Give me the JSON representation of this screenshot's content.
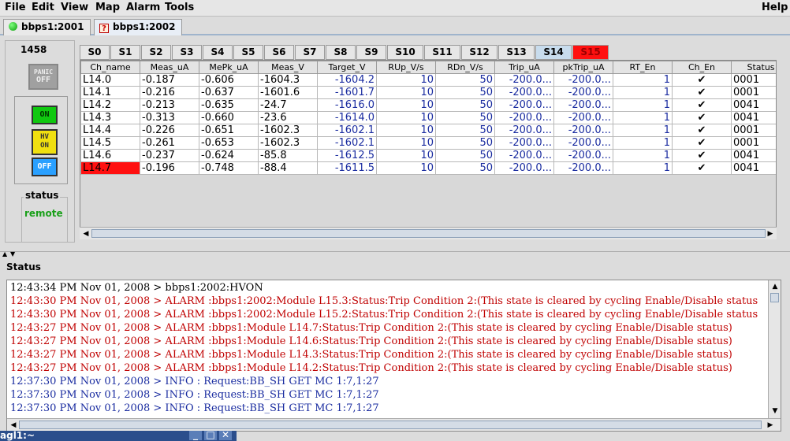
{
  "menu": [
    "File",
    "Edit",
    "View",
    "Map",
    "Alarm",
    "Tools"
  ],
  "help": "Help",
  "window_tabs": [
    {
      "label": "bbps1:2001"
    },
    {
      "label": "bbps1:2002"
    }
  ],
  "crate": "1458",
  "controls": {
    "panic_top": "PANIC",
    "panic_bottom": "OFF",
    "on": "ON",
    "hv_top": "HV",
    "hv_bottom": "ON",
    "off": "OFF"
  },
  "status": {
    "title": "status",
    "value": "remote"
  },
  "slot_tabs": [
    "S0",
    "S1",
    "S2",
    "S3",
    "S4",
    "S5",
    "S6",
    "S7",
    "S8",
    "S9",
    "S10",
    "S11",
    "S12",
    "S13",
    "S14",
    "S15"
  ],
  "columns": [
    "Ch_name",
    "Meas_uA",
    "MePk_uA",
    "Meas_V",
    "Target_V",
    "RUp_V/s",
    "RDn_V/s",
    "Trip_uA",
    "pkTrip_uA",
    "RT_En",
    "Ch_En",
    "Status"
  ],
  "rows": [
    [
      "L14.0",
      "-0.187",
      "-0.606",
      "-1604.3",
      "-1604.2",
      "10",
      "50",
      "-200.0...",
      "-200.0...",
      "1",
      "✔",
      "0001"
    ],
    [
      "L14.1",
      "-0.216",
      "-0.637",
      "-1601.6",
      "-1601.7",
      "10",
      "50",
      "-200.0...",
      "-200.0...",
      "1",
      "✔",
      "0001"
    ],
    [
      "L14.2",
      "-0.213",
      "-0.635",
      "-24.7",
      "-1616.0",
      "10",
      "50",
      "-200.0...",
      "-200.0...",
      "1",
      "✔",
      "0041"
    ],
    [
      "L14.3",
      "-0.313",
      "-0.660",
      "-23.6",
      "-1614.0",
      "10",
      "50",
      "-200.0...",
      "-200.0...",
      "1",
      "✔",
      "0041"
    ],
    [
      "L14.4",
      "-0.226",
      "-0.651",
      "-1602.3",
      "-1602.1",
      "10",
      "50",
      "-200.0...",
      "-200.0...",
      "1",
      "✔",
      "0001"
    ],
    [
      "L14.5",
      "-0.261",
      "-0.653",
      "-1602.3",
      "-1602.1",
      "10",
      "50",
      "-200.0...",
      "-200.0...",
      "1",
      "✔",
      "0001"
    ],
    [
      "L14.6",
      "-0.237",
      "-0.624",
      "-85.8",
      "-1612.5",
      "10",
      "50",
      "-200.0...",
      "-200.0...",
      "1",
      "✔",
      "0041"
    ],
    [
      "L14.7",
      "-0.196",
      "-0.748",
      "-88.4",
      "-1611.5",
      "10",
      "50",
      "-200.0...",
      "-200.0...",
      "1",
      "✔",
      "0041"
    ]
  ],
  "log_title": "Status",
  "log": [
    {
      "text": "12:43:34 PM Nov 01, 2008 > bbps1:2002:HVON",
      "color": "#000000"
    },
    {
      "text": "12:43:30 PM Nov 01, 2008 > ALARM :bbps1:2002:Module L15.3:Status:Trip Condition 2:(This state is cleared by cycling Enable/Disable status",
      "color": "#c00000"
    },
    {
      "text": "12:43:30 PM Nov 01, 2008 > ALARM :bbps1:2002:Module L15.2:Status:Trip Condition 2:(This state is cleared by cycling Enable/Disable status",
      "color": "#c00000"
    },
    {
      "text": "12:43:27 PM Nov 01, 2008 > ALARM :bbps1:Module L14.7:Status:Trip Condition 2:(This state is cleared by cycling Enable/Disable status)",
      "color": "#c00000"
    },
    {
      "text": "12:43:27 PM Nov 01, 2008 > ALARM :bbps1:Module L14.6:Status:Trip Condition 2:(This state is cleared by cycling Enable/Disable status)",
      "color": "#c00000"
    },
    {
      "text": "12:43:27 PM Nov 01, 2008 > ALARM :bbps1:Module L14.3:Status:Trip Condition 2:(This state is cleared by cycling Enable/Disable status)",
      "color": "#c00000"
    },
    {
      "text": "12:43:27 PM Nov 01, 2008 > ALARM :bbps1:Module L14.2:Status:Trip Condition 2:(This state is cleared by cycling Enable/Disable status)",
      "color": "#c00000"
    },
    {
      "text": "12:37:30 PM Nov 01, 2008 > INFO : Request:BB_SH GET MC 1:7,1:27",
      "color": "#1a2ca0"
    },
    {
      "text": "12:37:30 PM Nov 01, 2008 > INFO : Request:BB_SH GET MC 1:7,1:27",
      "color": "#1a2ca0"
    },
    {
      "text": "12:37:30 PM Nov 01, 2008 > INFO : Request:BB_SH GET MC 1:7,1:27",
      "color": "#1a2ca0"
    }
  ],
  "taskbar": "agl1:~"
}
